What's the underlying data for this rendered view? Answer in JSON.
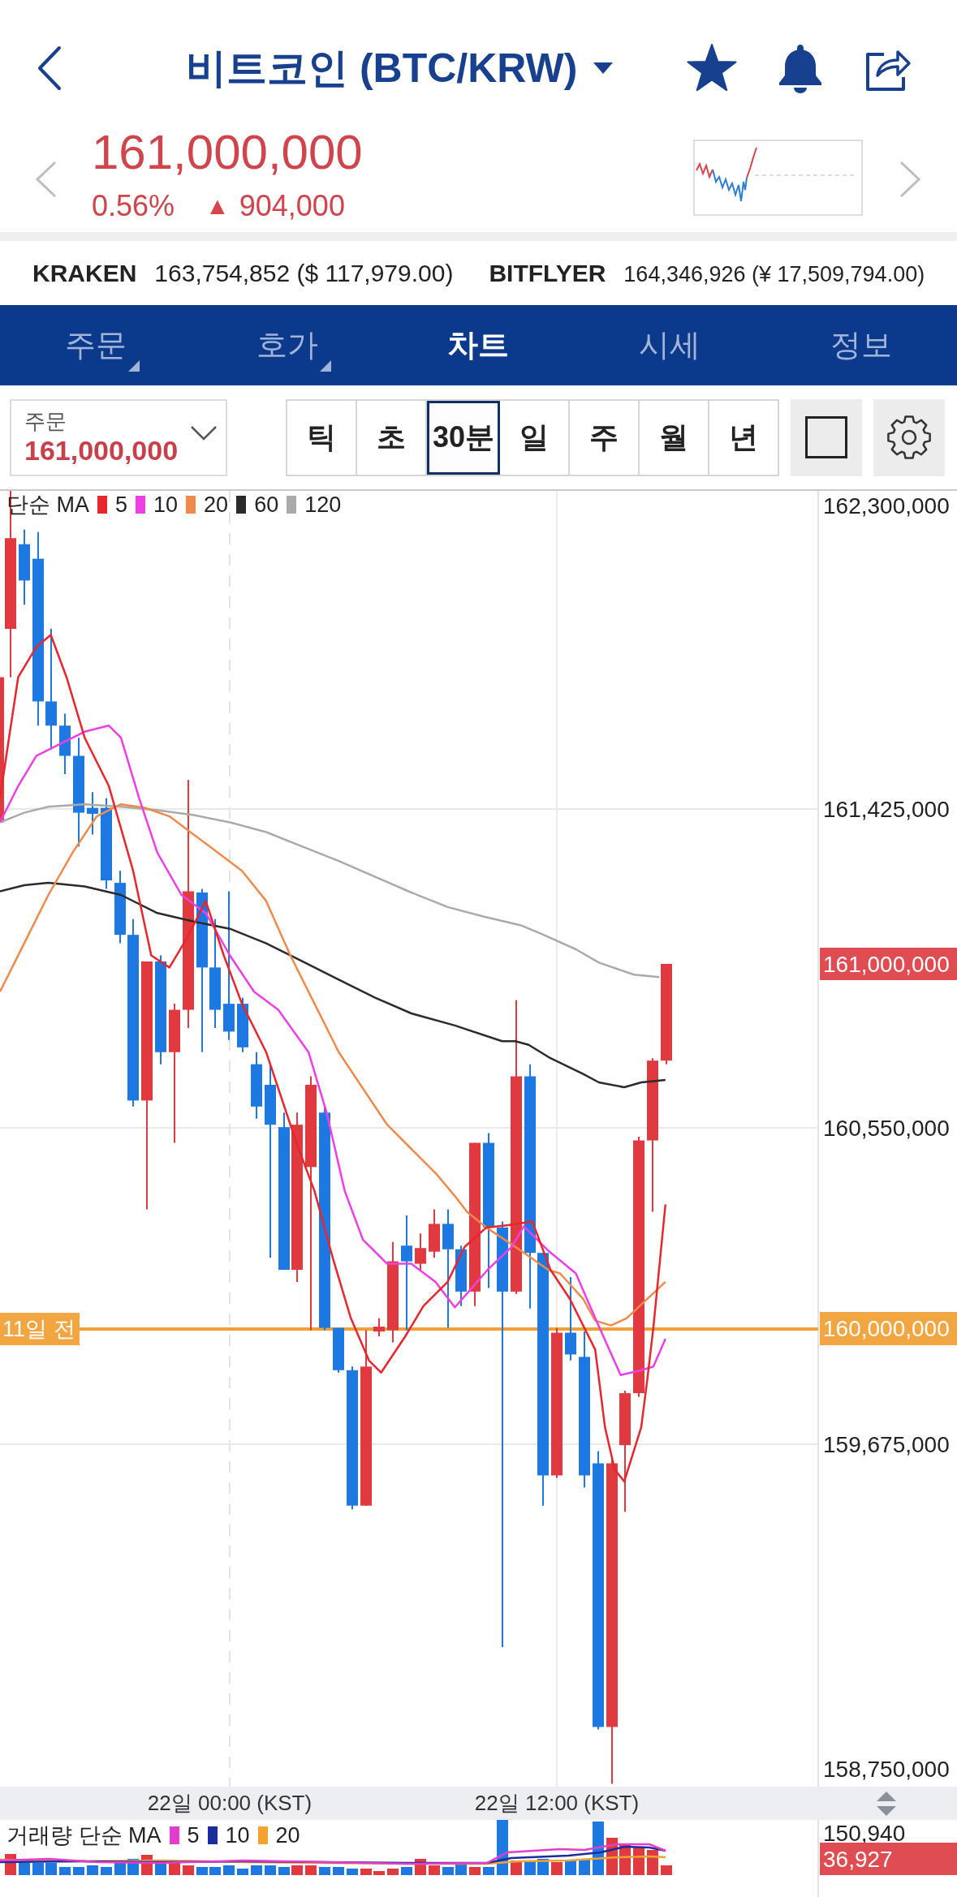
{
  "header": {
    "title": "비트코인 (BTC/KRW)"
  },
  "price": {
    "value": "161,000,000",
    "change_percent": "0.56%",
    "change_arrow": "▲",
    "change_amount": "904,000"
  },
  "exchanges": [
    {
      "name": "KRAKEN",
      "price": "163,754,852 ($ 117,979.00)"
    },
    {
      "name": "BITFLYER",
      "price": "164,346,926 (¥ 17,509,794.00)"
    }
  ],
  "tabs": [
    {
      "label": "주문",
      "selected": false,
      "has_menu": true
    },
    {
      "label": "호가",
      "selected": false,
      "has_menu": true
    },
    {
      "label": "차트",
      "selected": true,
      "has_menu": false
    },
    {
      "label": "시세",
      "selected": false,
      "has_menu": false
    },
    {
      "label": "정보",
      "selected": false,
      "has_menu": false
    }
  ],
  "order_select": {
    "label": "주문",
    "value": "161,000,000"
  },
  "periods": [
    {
      "label": "틱",
      "selected": false
    },
    {
      "label": "초",
      "selected": false
    },
    {
      "label": "30분",
      "selected": true
    },
    {
      "label": "일",
      "selected": false
    },
    {
      "label": "주",
      "selected": false
    },
    {
      "label": "월",
      "selected": false
    },
    {
      "label": "년",
      "selected": false
    }
  ],
  "chart": {
    "legend": {
      "label": "단순 MA",
      "items": [
        {
          "label": "5",
          "color": "#e8262c"
        },
        {
          "label": "10",
          "color": "#ee3fe6"
        },
        {
          "label": "20",
          "color": "#f08a4c"
        },
        {
          "label": "60",
          "color": "#2b2b2b"
        },
        {
          "label": "120",
          "color": "#aaaaaa"
        }
      ]
    },
    "y_axis_labels": [
      "162,300,000",
      "161,425,000",
      "160,550,000",
      "159,675,000",
      "158,750,000"
    ],
    "current_price_tag": "161,000,000",
    "level_line": {
      "label": "11일 전",
      "price": "160,000,000"
    },
    "x_axis_labels": [
      "22일 00:00 (KST)",
      "22일 12:00 (KST)"
    ]
  },
  "volume": {
    "legend": {
      "label": "거래량 단순 MA",
      "items": [
        {
          "label": "5",
          "color": "#e43ccf"
        },
        {
          "label": "10",
          "color": "#1b2c9c"
        },
        {
          "label": "20",
          "color": "#f2a22e"
        }
      ]
    },
    "axis_label": "150,940",
    "current_tag": "36,927"
  }
}
